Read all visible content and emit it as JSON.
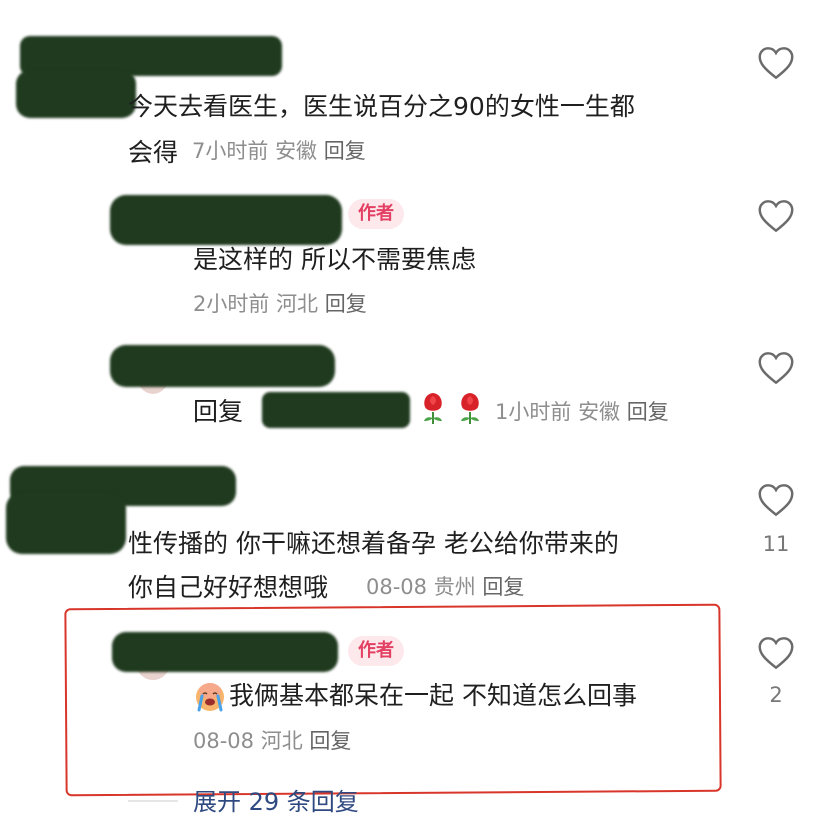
{
  "comments": [
    {
      "text_line1": "今天去看医生，医生说百分之90的女性一生都",
      "text_line2": "会得",
      "time": "7小时前",
      "location": "安徽",
      "reply_label": "回复"
    },
    {
      "badge": "作者",
      "text": "是这样的 所以不需要焦虑",
      "time": "2小时前",
      "location": "河北",
      "reply_label": "回复"
    },
    {
      "reply_prefix": "回复",
      "time": "1小时前",
      "location": "安徽",
      "reply_label": "回复"
    },
    {
      "text_line1": "性传播的 你干嘛还想着备孕 老公给你带来的",
      "text_line2": "你自己好好想想哦",
      "time": "08-08",
      "location": "贵州",
      "reply_label": "回复",
      "likes": "11"
    },
    {
      "badge": "作者",
      "text": "我俩基本都呆在一起 不知道怎么回事",
      "time": "08-08",
      "location": "河北",
      "reply_label": "回复",
      "likes": "2"
    }
  ],
  "expand_label": "展开 29 条回复",
  "icons": {
    "like": "heart-outline-icon",
    "flower": "rose-emoji-icon",
    "crying": "crying-face-emoji-icon"
  },
  "colors": {
    "author_badge_bg": "#fde8ec",
    "author_badge_text": "#e34064",
    "highlight_border": "#d8362a",
    "expand_link": "#2f4a80"
  }
}
